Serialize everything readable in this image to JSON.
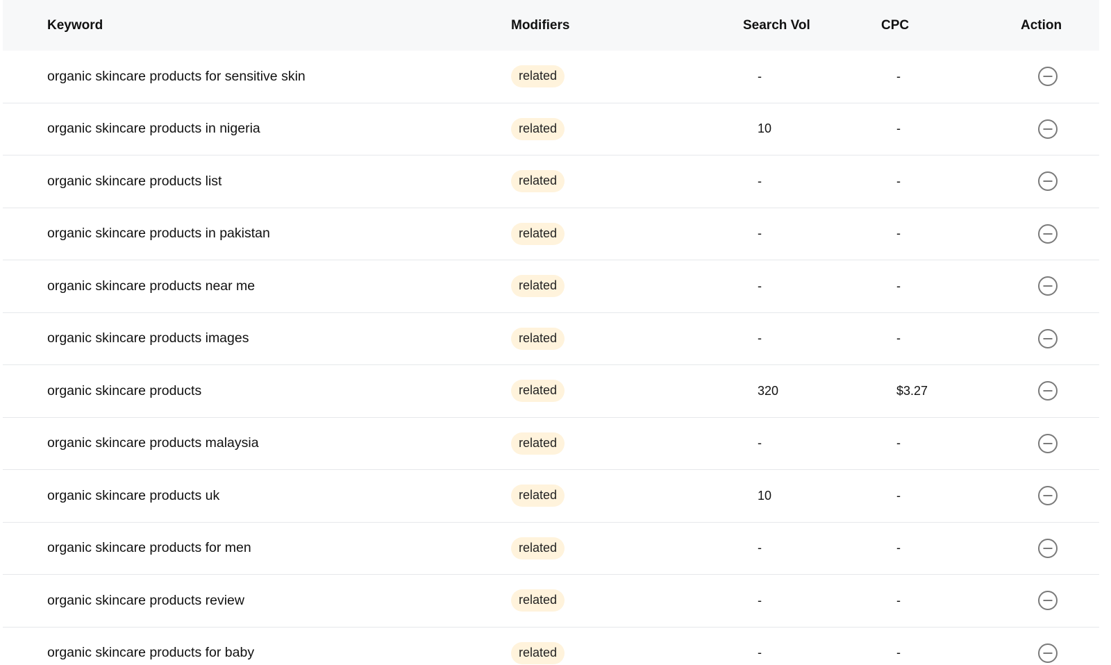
{
  "table": {
    "columns": {
      "keyword": "Keyword",
      "modifiers": "Modifiers",
      "search_vol": "Search Vol",
      "cpc": "CPC",
      "action": "Action"
    },
    "rows": [
      {
        "keyword": "organic skincare products for sensitive skin",
        "modifier": "related",
        "search_vol": "-",
        "cpc": "-",
        "action_icon": "minus-circle-icon"
      },
      {
        "keyword": "organic skincare products in nigeria",
        "modifier": "related",
        "search_vol": "10",
        "cpc": "-",
        "action_icon": "minus-circle-icon"
      },
      {
        "keyword": "organic skincare products list",
        "modifier": "related",
        "search_vol": "-",
        "cpc": "-",
        "action_icon": "minus-circle-icon"
      },
      {
        "keyword": "organic skincare products in pakistan",
        "modifier": "related",
        "search_vol": "-",
        "cpc": "-",
        "action_icon": "minus-circle-icon"
      },
      {
        "keyword": "organic skincare products near me",
        "modifier": "related",
        "search_vol": "-",
        "cpc": "-",
        "action_icon": "minus-circle-icon"
      },
      {
        "keyword": "organic skincare products images",
        "modifier": "related",
        "search_vol": "-",
        "cpc": "-",
        "action_icon": "minus-circle-icon"
      },
      {
        "keyword": "organic skincare products",
        "modifier": "related",
        "search_vol": "320",
        "cpc": "$3.27",
        "action_icon": "minus-circle-icon"
      },
      {
        "keyword": "organic skincare products malaysia",
        "modifier": "related",
        "search_vol": "-",
        "cpc": "-",
        "action_icon": "minus-circle-icon"
      },
      {
        "keyword": "organic skincare products uk",
        "modifier": "related",
        "search_vol": "10",
        "cpc": "-",
        "action_icon": "minus-circle-icon"
      },
      {
        "keyword": "organic skincare products for men",
        "modifier": "related",
        "search_vol": "-",
        "cpc": "-",
        "action_icon": "minus-circle-icon"
      },
      {
        "keyword": "organic skincare products review",
        "modifier": "related",
        "search_vol": "-",
        "cpc": "-",
        "action_icon": "minus-circle-icon"
      },
      {
        "keyword": "organic skincare products for baby",
        "modifier": "related",
        "search_vol": "-",
        "cpc": "-",
        "action_icon": "minus-circle-icon"
      }
    ]
  },
  "colors": {
    "header_bg": "#f7f8f9",
    "badge_bg": "#fff3dc",
    "row_border": "#e6e8eb",
    "icon_stroke": "#7a7a7a"
  }
}
